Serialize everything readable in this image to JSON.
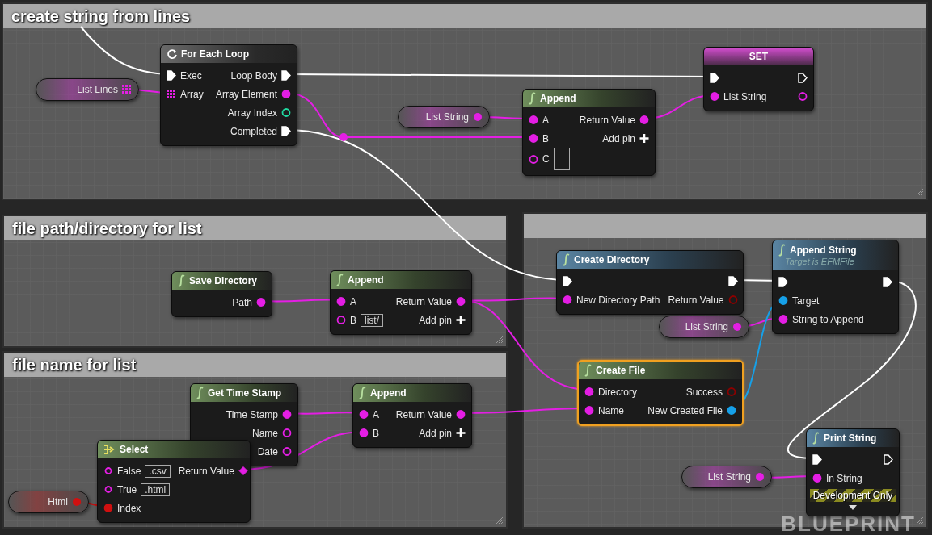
{
  "comments": [
    {
      "kind": "comment",
      "title": "create string from lines"
    },
    {
      "kind": "comment",
      "title": "file path/directory for list"
    },
    {
      "kind": "comment",
      "title": "file name for list"
    },
    {
      "kind": "comment"
    }
  ],
  "nodes": [
    {
      "kind": "variable",
      "label": "List Lines",
      "pin": {
        "kind": "array"
      },
      "selected": false
    },
    {
      "kind": "loop",
      "title": "For Each Loop",
      "selected": false,
      "inputs": [
        {
          "label": "Exec",
          "kind": "exec",
          "linked": true
        },
        {
          "label": "Array",
          "kind": "array",
          "linked": true
        }
      ],
      "outputs": [
        {
          "label": "Loop Body",
          "kind": "exec",
          "linked": true
        },
        {
          "label": "Array Element",
          "kind": "string",
          "linked": true
        },
        {
          "label": "Array Index",
          "kind": "int",
          "linked": false
        },
        {
          "label": "Completed",
          "kind": "exec",
          "linked": true
        }
      ]
    },
    {
      "kind": "variable",
      "label": "List String",
      "pin": {
        "kind": "string"
      },
      "selected": false
    },
    {
      "kind": "pure",
      "title": "Append",
      "selected": false,
      "inputs": [
        {
          "label": "A",
          "kind": "string",
          "linked": true
        },
        {
          "label": "B",
          "kind": "string",
          "linked": true
        },
        {
          "label": "C",
          "kind": "string",
          "linked": false,
          "field": true
        }
      ],
      "outputs": [
        {
          "label": "Return Value",
          "kind": "string",
          "linked": true
        },
        {
          "label": "Add pin",
          "kind": "add"
        }
      ]
    },
    {
      "kind": "set",
      "title": "SET",
      "selected": false,
      "inputs": [
        {
          "kind": "exec",
          "linked": true
        },
        {
          "label": "List String",
          "kind": "string",
          "linked": true
        }
      ],
      "outputs": [
        {
          "kind": "exec",
          "linked": false
        },
        {
          "kind": "string",
          "linked": false
        }
      ]
    },
    {
      "kind": "pure",
      "title": "Save Directory",
      "selected": false,
      "outputs": [
        {
          "label": "Path",
          "kind": "string",
          "linked": true
        }
      ]
    },
    {
      "kind": "pure",
      "title": "Append",
      "selected": false,
      "inputs": [
        {
          "label": "A",
          "kind": "string",
          "linked": true
        },
        {
          "label": "B",
          "kind": "string",
          "linked": false,
          "field": true,
          "value": "list/"
        }
      ],
      "outputs": [
        {
          "label": "Return Value",
          "kind": "string",
          "linked": true
        },
        {
          "label": "Add pin",
          "kind": "add"
        }
      ]
    },
    {
      "kind": "pure",
      "title": "Get Time Stamp",
      "selected": false,
      "outputs": [
        {
          "label": "Time Stamp",
          "kind": "string",
          "linked": true
        },
        {
          "label": "Name",
          "kind": "string",
          "linked": false
        },
        {
          "label": "Date",
          "kind": "string",
          "linked": false
        }
      ]
    },
    {
      "kind": "select",
      "title": "Select",
      "selected": false,
      "inputs": [
        {
          "label": "False",
          "kind": "option",
          "linked": false,
          "field": true,
          "value": ".csv"
        },
        {
          "label": "True",
          "kind": "option",
          "linked": false,
          "field": true,
          "value": ".html"
        },
        {
          "label": "Index",
          "kind": "bool",
          "linked": true
        }
      ],
      "outputs": [
        {
          "label": "Return Value",
          "kind": "wildcard",
          "linked": true
        }
      ]
    },
    {
      "kind": "pure",
      "title": "Append",
      "selected": false,
      "inputs": [
        {
          "label": "A",
          "kind": "string",
          "linked": true
        },
        {
          "label": "B",
          "kind": "string",
          "linked": true
        }
      ],
      "outputs": [
        {
          "label": "Return Value",
          "kind": "string",
          "linked": true
        },
        {
          "label": "Add pin",
          "kind": "add"
        }
      ]
    },
    {
      "kind": "variable",
      "label": "Html",
      "pin": {
        "kind": "bool"
      },
      "selected": false
    },
    {
      "kind": "function",
      "title": "Create Directory",
      "selected": false,
      "inputs": [
        {
          "kind": "exec",
          "linked": true
        },
        {
          "label": "New Directory Path",
          "kind": "string",
          "linked": true
        }
      ],
      "outputs": [
        {
          "kind": "exec",
          "linked": true
        },
        {
          "label": "Return Value",
          "kind": "flag",
          "linked": false
        }
      ]
    },
    {
      "kind": "function",
      "title": "Append String",
      "subtitle": "Target is EFMFile",
      "selected": false,
      "inputs": [
        {
          "kind": "exec",
          "linked": true
        },
        {
          "label": "Target",
          "kind": "object",
          "linked": true
        },
        {
          "label": "String to Append",
          "kind": "string",
          "linked": true
        }
      ],
      "outputs": [
        {
          "kind": "exec",
          "linked": true
        }
      ]
    },
    {
      "kind": "variable",
      "label": "List String",
      "pin": {
        "kind": "string"
      },
      "selected": false
    },
    {
      "kind": "pure",
      "title": "Create File",
      "selected": true,
      "inputs": [
        {
          "label": "Directory",
          "kind": "string",
          "linked": true
        },
        {
          "label": "Name",
          "kind": "string",
          "linked": true
        }
      ],
      "outputs": [
        {
          "label": "Success",
          "kind": "flag",
          "linked": false
        },
        {
          "label": "New Created File",
          "kind": "object",
          "linked": true
        }
      ]
    },
    {
      "kind": "function",
      "title": "Print String",
      "selected": false,
      "banner": "Development Only",
      "collapsed_options": true,
      "inputs": [
        {
          "kind": "exec",
          "linked": true
        },
        {
          "label": "In String",
          "kind": "string",
          "linked": true
        }
      ],
      "outputs": [
        {
          "kind": "exec",
          "linked": false
        }
      ]
    },
    {
      "kind": "variable",
      "label": "List String",
      "pin": {
        "kind": "string"
      },
      "selected": false
    }
  ],
  "graph_label": "BLUEPRINT"
}
